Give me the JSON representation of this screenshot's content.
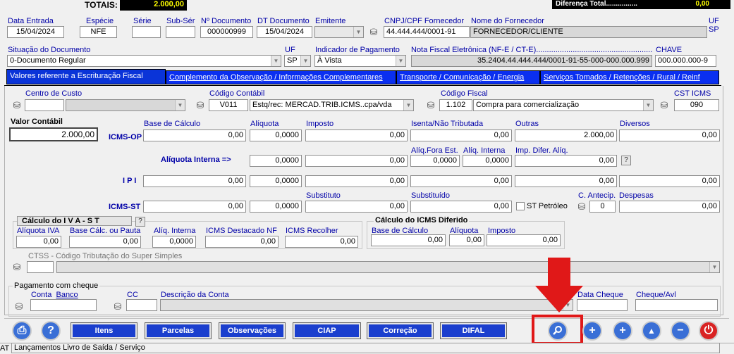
{
  "top_bar": {
    "totais_label": "TOTAIS:",
    "totais_value": "2.000,00",
    "diferenca_label": "Diferença Total................",
    "diferenca_value": "0,00"
  },
  "header": {
    "data_entrada_label": "Data Entrada",
    "data_entrada": "15/04/2024",
    "especie_label": "Espécie",
    "especie": "NFE",
    "serie_label": "Série",
    "serie": "",
    "sub_serie_label": "Sub-Sér",
    "sub_serie": "",
    "num_doc_label": "Nº Documento",
    "num_doc": "000000999",
    "dt_doc_label": "DT Documento",
    "dt_doc": "15/04/2024",
    "emitente_label": "Emitente",
    "emitente": "",
    "cnpj_label": "CNPJ/CPF Fornecedor",
    "cnpj": "44.444.444/0001-91",
    "nome_label": "Nome do Fornecedor",
    "nome": "FORNECEDOR/CLIENTE",
    "uf_label": "UF",
    "uf_value": "SP",
    "situacao_label": "Situação do Documento",
    "situacao": "0-Documento Regular",
    "uf2_label": "UF",
    "uf2": "SP",
    "ind_pag_label": "Indicador de Pagamento",
    "ind_pag": "À Vista",
    "nfe_label": "Nota Fiscal Eletrônica (NF-E / CT-E).............................................................=",
    "nfe": "35.2404.44.444.444/0001-91-55-000-000.000.999",
    "chave_label": "CHAVE",
    "chave": "000.000.000-9"
  },
  "tabs": [
    {
      "label": "Valores referente a Escrituração Fiscal"
    },
    {
      "label": "Complemento da Observação / Informações Complementares"
    },
    {
      "label": "Transporte / Comunicação / Energia"
    },
    {
      "label": "Serviços Tomados / Retenções / Rural / Reinf"
    }
  ],
  "fiscal": {
    "centro_custo_label": "Centro de Custo",
    "centro_custo": "",
    "cod_contabil_label": "Código Contábil",
    "cod_contabil": "V011",
    "cod_contabil_desc": "Estq/rec: MERCAD.TRIB.ICMS..cpa/vda",
    "cod_fiscal_label": "Código Fiscal",
    "cod_fiscal": "1.102",
    "cod_fiscal_desc": "Compra para comercialização",
    "cst_label": "CST ICMS",
    "cst": "090",
    "valor_contabil_label": "Valor Contábil",
    "valor_contabil": "2.000,00",
    "icms_op_label": "ICMS-OP",
    "base_calc_label": "Base de Cálculo",
    "aliquota_label": "Alíquota",
    "imposto_label": "Imposto",
    "isenta_label": "Isenta/Não Tributada",
    "outras_label": "Outras",
    "diversos_label": "Diversos",
    "op_base": "0,00",
    "op_aliq": "0,0000",
    "op_imposto": "0,00",
    "op_isenta": "0,00",
    "op_outras": "2.000,00",
    "op_diversos": "0,00",
    "aliq_interna_label": "Alíquota Interna =>",
    "ai_aliq": "0,0000",
    "ai_imposto": "0,00",
    "aliq_fora_label": "Alíq.Fora Est.",
    "aliq_fora": "0,0000",
    "aliq_int2_label": "Alíq. Interna",
    "aliq_int2": "0,0000",
    "imp_difer_label": "Imp. Difer. Alíq.",
    "imp_difer": "0,00",
    "ipi_label": "I P I",
    "ipi_base": "0,00",
    "ipi_aliq": "0,0000",
    "ipi_imposto": "0,00",
    "ipi_isenta": "0,00",
    "ipi_outras": "0,00",
    "ipi_diversos": "0,00",
    "icms_st_label": "ICMS-ST",
    "substituto_label": "Substituto",
    "substituido_label": "Substituído",
    "st_base": "0,00",
    "st_aliq": "0,0000",
    "st_substituto": "0,00",
    "st_substituido": "0,00",
    "st_petroleo_label": "ST Petróleo",
    "c_antecip_label": "C. Antecip.",
    "c_antecip": "0",
    "despesas_label": "Despesas",
    "despesas": "0,00"
  },
  "iva": {
    "title": "Cálculo  do  I V A - S T",
    "aliq_iva_label": "Alíquota IVA",
    "aliq_iva": "0,00",
    "base_pauta_label": "Base Cálc. ou Pauta",
    "base_pauta": "0,00",
    "aliq_int_label": "Alíq. Interna",
    "aliq_int": "0,0000",
    "icms_dest_label": "ICMS Destacado NF",
    "icms_dest": "0,00",
    "icms_rec_label": "ICMS Recolher",
    "icms_rec": "0,00"
  },
  "diferido": {
    "title": "Cálculo do ICMS Diferido",
    "base_label": "Base de Cálculo",
    "base": "0,00",
    "aliq_label": "Alíquota",
    "aliq": "0,00",
    "imposto_label": "Imposto",
    "imposto": "0,00"
  },
  "ctss": {
    "label": "CTSS - Código Tributação do Super Simples",
    "code": "",
    "desc": ""
  },
  "cheque": {
    "title": "Pagamento com cheque",
    "conta_label": "Conta",
    "banco_label": "Banco",
    "conta": "",
    "cc_label": "CC",
    "cc": "",
    "desc_label": "Descrição da Conta",
    "desc": "",
    "data_label": "Data Cheque",
    "data": "",
    "cheque_label": "Cheque/Avl",
    "cheque": ""
  },
  "toolbar": {
    "itens": "Itens",
    "parcelas": "Parcelas",
    "observacoes": "Observações",
    "ciap": "CIAP",
    "correcao": "Correção",
    "difal": "DIFAL"
  },
  "status_bar": {
    "prefix": "AT",
    "text": "Lançamentos Livro de Saída / Serviço"
  },
  "colors": {
    "accent": "#1b3fce",
    "highlight_red": "#e01818",
    "label_blue": "#0000a8"
  }
}
